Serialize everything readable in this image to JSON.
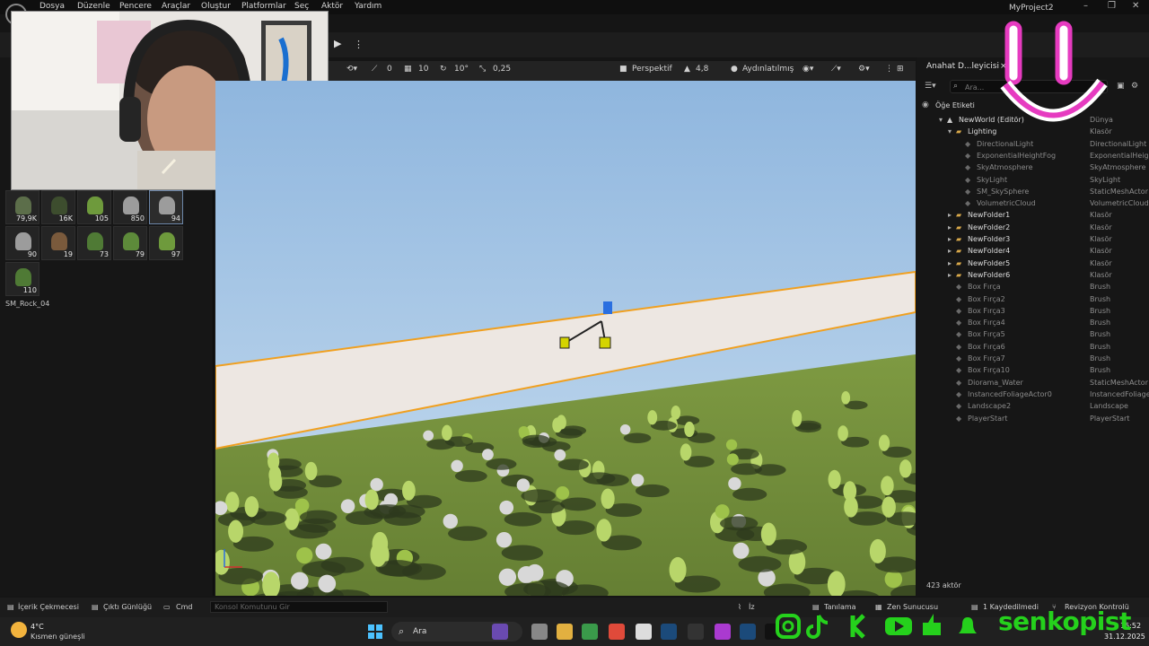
{
  "menubar": {
    "items": [
      "Dosya",
      "Düzenle",
      "Pencere",
      "Araçlar",
      "Oluştur",
      "Platformlar",
      "Seç",
      "Aktör",
      "Yardım"
    ],
    "app_title": "MyProject2"
  },
  "foliage": {
    "tiles": [
      {
        "count": "79,9K",
        "icon": "terrain-icon"
      },
      {
        "count": "16K",
        "icon": "grass-icon"
      },
      {
        "count": "105",
        "icon": "tree-icon"
      },
      {
        "count": "850",
        "icon": "rock-icon"
      },
      {
        "count": "94",
        "icon": "rock-icon",
        "selected": true
      },
      {
        "count": "90",
        "icon": "rock-icon"
      },
      {
        "count": "19",
        "icon": "stump-icon"
      },
      {
        "count": "73",
        "icon": "pine-icon"
      },
      {
        "count": "79",
        "icon": "bush-icon"
      },
      {
        "count": "97",
        "icon": "tree-icon"
      },
      {
        "count": "110",
        "icon": "pine-icon"
      }
    ],
    "asset_label": "SM_Rock_04"
  },
  "viewport_toolbar": {
    "rotation_snap": "0",
    "grid_snap": "10",
    "angle_snap": "10°",
    "scale_snap": "0,25",
    "view_mode": "Perspektif",
    "camera_speed": "4,8",
    "lighting_mode": "Aydınlatılmış"
  },
  "outliner": {
    "tab_label": "Anahat D...leyicisi",
    "close_glyph": "×",
    "search_placeholder": "Ara...",
    "column_label": "Öğe Etiketi",
    "rows": [
      {
        "name": "NewWorld (Editör)",
        "type": "Dünya",
        "indent": 0,
        "kind": "world"
      },
      {
        "name": "Lighting",
        "type": "Klasör",
        "indent": 1,
        "kind": "folder-open"
      },
      {
        "name": "DirectionalLight",
        "type": "DirectionalLight",
        "indent": 2,
        "kind": "actor-dim"
      },
      {
        "name": "ExponentialHeightFog",
        "type": "ExponentialHeig",
        "indent": 2,
        "kind": "actor-dim"
      },
      {
        "name": "SkyAtmosphere",
        "type": "SkyAtmosphere",
        "indent": 2,
        "kind": "actor-dim"
      },
      {
        "name": "SkyLight",
        "type": "SkyLight",
        "indent": 2,
        "kind": "actor-dim"
      },
      {
        "name": "SM_SkySphere",
        "type": "StaticMeshActor",
        "indent": 2,
        "kind": "actor-dim"
      },
      {
        "name": "VolumetricCloud",
        "type": "VolumetricCloud",
        "indent": 2,
        "kind": "actor-dim"
      },
      {
        "name": "NewFolder1",
        "type": "Klasör",
        "indent": 1,
        "kind": "folder"
      },
      {
        "name": "NewFolder2",
        "type": "Klasör",
        "indent": 1,
        "kind": "folder"
      },
      {
        "name": "NewFolder3",
        "type": "Klasör",
        "indent": 1,
        "kind": "folder"
      },
      {
        "name": "NewFolder4",
        "type": "Klasör",
        "indent": 1,
        "kind": "folder"
      },
      {
        "name": "NewFolder5",
        "type": "Klasör",
        "indent": 1,
        "kind": "folder"
      },
      {
        "name": "NewFolder6",
        "type": "Klasör",
        "indent": 1,
        "kind": "folder"
      },
      {
        "name": "Box Fırça",
        "type": "Brush",
        "indent": 1,
        "kind": "actor-dim"
      },
      {
        "name": "Box Fırça2",
        "type": "Brush",
        "indent": 1,
        "kind": "actor-dim"
      },
      {
        "name": "Box Fırça3",
        "type": "Brush",
        "indent": 1,
        "kind": "actor-dim"
      },
      {
        "name": "Box Fırça4",
        "type": "Brush",
        "indent": 1,
        "kind": "actor-dim"
      },
      {
        "name": "Box Fırça5",
        "type": "Brush",
        "indent": 1,
        "kind": "actor-dim"
      },
      {
        "name": "Box Fırça6",
        "type": "Brush",
        "indent": 1,
        "kind": "actor-dim"
      },
      {
        "name": "Box Fırça7",
        "type": "Brush",
        "indent": 1,
        "kind": "actor-dim"
      },
      {
        "name": "Box Fırça10",
        "type": "Brush",
        "indent": 1,
        "kind": "actor-dim"
      },
      {
        "name": "Diorama_Water",
        "type": "StaticMeshActor",
        "indent": 1,
        "kind": "actor-dim"
      },
      {
        "name": "InstancedFoliageActor0",
        "type": "InstancedFoliage",
        "indent": 1,
        "kind": "actor-dim"
      },
      {
        "name": "Landscape2",
        "type": "Landscape",
        "indent": 1,
        "kind": "actor-dim"
      },
      {
        "name": "PlayerStart",
        "type": "PlayerStart",
        "indent": 1,
        "kind": "actor-dim"
      }
    ],
    "actor_count": "423 aktör"
  },
  "statusbar": {
    "content_drawer": "İçerik Çekmecesi",
    "output_log": "Çıktı Günlüğü",
    "cmd": "Cmd",
    "console_placeholder": "Konsol Komutunu Gir",
    "trace": "İz",
    "diagnostics": "Tanılama",
    "zen_server": "Zen Sunucusu",
    "unsaved": "1 Kaydedilmedi",
    "revision": "Revizyon Kontrolü"
  },
  "taskbar": {
    "temperature": "4°C",
    "weather": "Kısmen güneşli",
    "search_label": "Ara",
    "time": "15:52",
    "date": "31.12.2025"
  },
  "overlay": {
    "brand": "senkopist"
  },
  "colors": {
    "accent": "#2f8df5",
    "brand_green": "#25d11c",
    "smiley_pink": "#e63bc0",
    "selection_orange": "#f0a020"
  }
}
